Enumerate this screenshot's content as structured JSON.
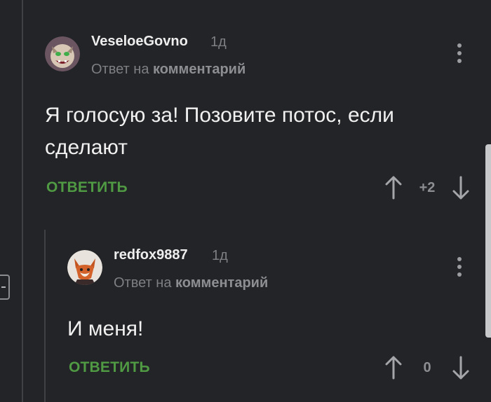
{
  "comments": [
    {
      "username": "VeseloeGovno",
      "age": "1д",
      "reply_prefix": "Ответ на",
      "reply_target": "комментарий",
      "text": "Я голосую за! Позовите потос, если сделают",
      "reply_label": "ОТВЕТИТЬ",
      "rating": "+2"
    },
    {
      "username": "redfox9887",
      "age": "1д",
      "reply_prefix": "Ответ на",
      "reply_target": "комментарий",
      "text": "И меня!",
      "reply_label": "ОТВЕТИТЬ",
      "rating": "0"
    }
  ],
  "colors": {
    "background": "#232427",
    "reply_action": "#4f9a43",
    "muted_text": "#7d7f83"
  },
  "icons": [
    "upvote-arrow-icon",
    "downvote-arrow-icon",
    "more-vertical-icon",
    "collapse-minus-icon"
  ]
}
